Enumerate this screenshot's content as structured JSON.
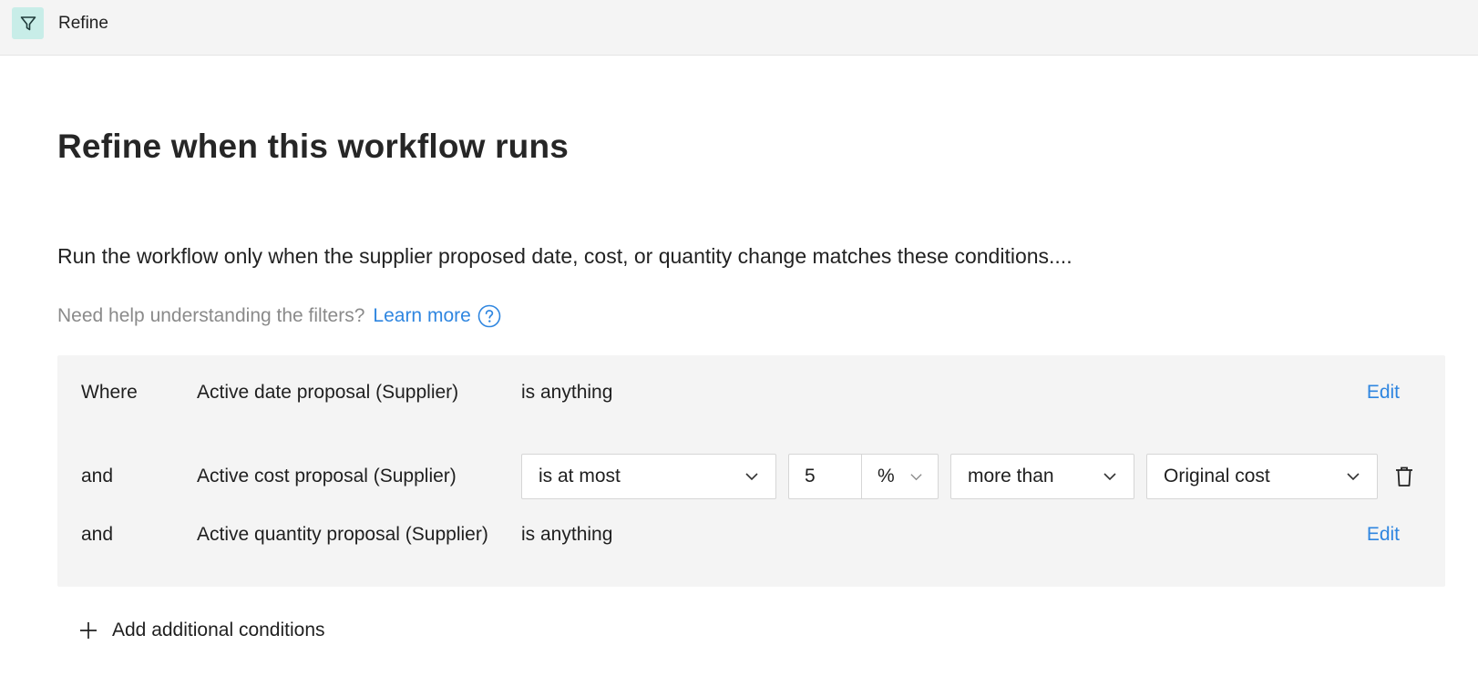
{
  "header": {
    "icon": "filter-icon",
    "title": "Refine"
  },
  "page": {
    "title": "Refine when this workflow runs",
    "description": "Run the workflow only when the supplier proposed date, cost, or quantity change matches these conditions....",
    "help_text": "Need help understanding the filters?",
    "learn_more": "Learn more",
    "help_icon": "question-circle-icon"
  },
  "conditions": [
    {
      "conjunction": "Where",
      "field": "Active date proposal (Supplier)",
      "operator": "is anything",
      "edit_label": "Edit"
    },
    {
      "conjunction": "and",
      "field": "Active cost proposal (Supplier)",
      "operator_select": "is at most",
      "amount": "5",
      "unit": "%",
      "comparison": "more than",
      "reference": "Original cost",
      "delete_icon": "trash-icon"
    },
    {
      "conjunction": "and",
      "field": "Active quantity proposal (Supplier)",
      "operator": "is anything",
      "edit_label": "Edit"
    }
  ],
  "add_conditions": {
    "label": "Add additional conditions",
    "icon": "plus-icon"
  },
  "colors": {
    "accent": "#2f86e0",
    "badge": "#c8ede8",
    "panel": "#f4f4f4"
  }
}
